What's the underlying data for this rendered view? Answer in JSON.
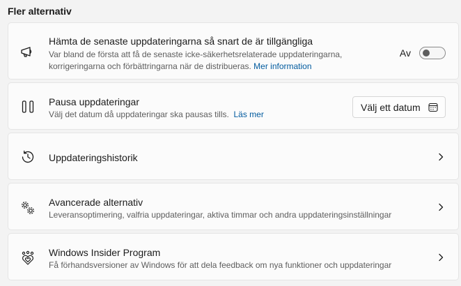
{
  "section": {
    "title": "Fler alternativ"
  },
  "latest_updates": {
    "title": "Hämta de senaste uppdateringarna så snart de är tillgängliga",
    "desc": "Var bland de första att få de senaste icke-säkerhetsrelaterade uppdateringarna, korrigeringarna och förbättringarna när de distribueras.",
    "link": "Mer information",
    "toggle_label": "Av",
    "toggle_on": false,
    "icon": "megaphone-icon"
  },
  "pause_updates": {
    "title": "Pausa uppdateringar",
    "desc": "Välj det datum då uppdateringar ska pausas tills.",
    "link": "Läs mer",
    "button_label": "Välj ett datum",
    "icon": "pause-icon",
    "button_icon": "calendar-icon"
  },
  "history": {
    "title": "Uppdateringshistorik",
    "icon": "history-icon"
  },
  "advanced": {
    "title": "Avancerade alternativ",
    "desc": "Leveransoptimering, valfria uppdateringar, aktiva timmar och andra uppdateringsinställningar",
    "icon": "gears-icon"
  },
  "insider": {
    "title": "Windows Insider Program",
    "desc": "Få förhandsversioner av Windows för att dela feedback om nya funktioner och uppdateringar",
    "icon": "insider-hearts-icon"
  }
}
